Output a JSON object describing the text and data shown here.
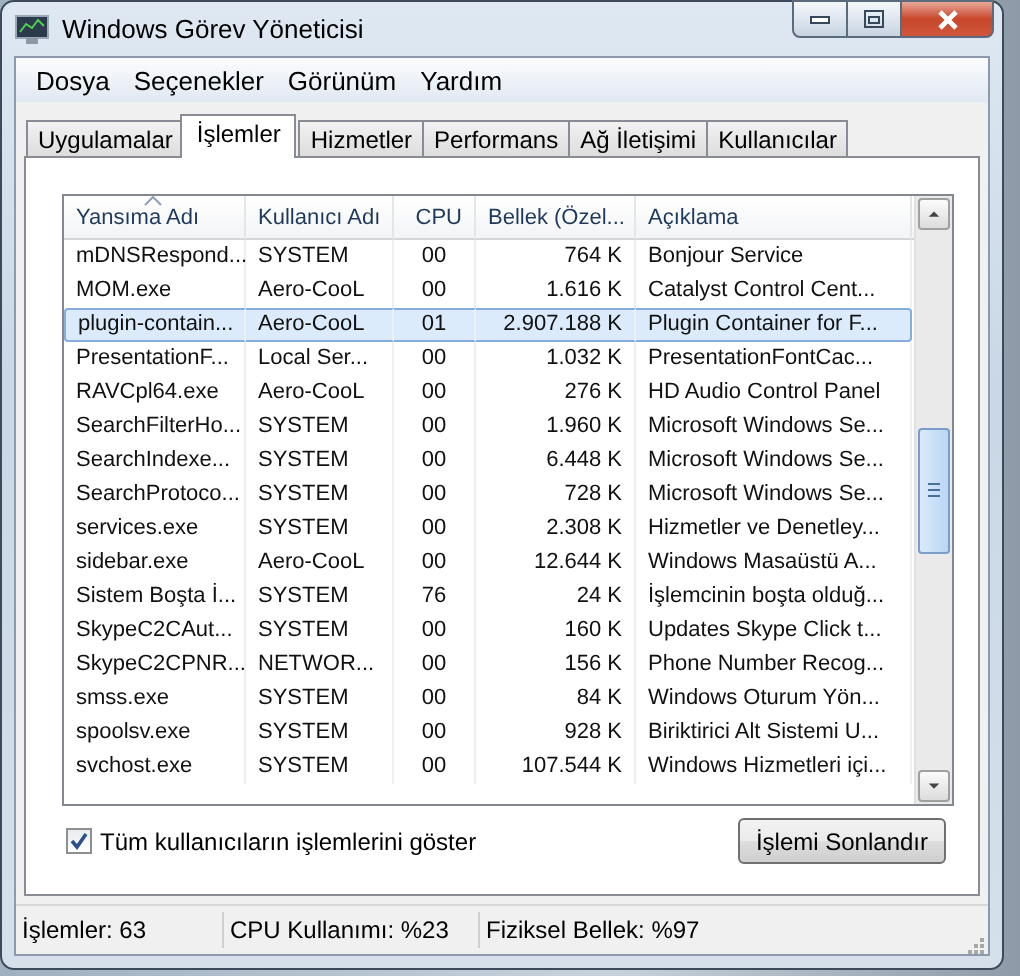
{
  "window": {
    "title": "Windows Görev Yöneticisi"
  },
  "menu": [
    "Dosya",
    "Seçenekler",
    "Görünüm",
    "Yardım"
  ],
  "tabs": [
    {
      "label": "Uygulamalar",
      "selected": false
    },
    {
      "label": "İşlemler",
      "selected": true
    },
    {
      "label": "Hizmetler",
      "selected": false
    },
    {
      "label": "Performans",
      "selected": false
    },
    {
      "label": "Ağ İletişimi",
      "selected": false
    },
    {
      "label": "Kullanıcılar",
      "selected": false
    }
  ],
  "process_table": {
    "columns": [
      {
        "label": "Yansıma Adı",
        "sorted": true
      },
      {
        "label": "Kullanıcı Adı",
        "sorted": false
      },
      {
        "label": "CPU",
        "sorted": false
      },
      {
        "label": "Bellek (Özel...",
        "sorted": false
      },
      {
        "label": "Açıklama",
        "sorted": false
      }
    ],
    "rows": [
      {
        "name": "mDNSRespond...",
        "user": "SYSTEM",
        "cpu": "00",
        "memory": "764 K",
        "description": "Bonjour Service",
        "selected": false
      },
      {
        "name": "MOM.exe",
        "user": "Aero-CooL",
        "cpu": "00",
        "memory": "1.616 K",
        "description": "Catalyst Control Cent...",
        "selected": false
      },
      {
        "name": "plugin-contain...",
        "user": "Aero-CooL",
        "cpu": "01",
        "memory": "2.907.188 K",
        "description": "Plugin Container for F...",
        "selected": true
      },
      {
        "name": "PresentationF...",
        "user": "Local Ser...",
        "cpu": "00",
        "memory": "1.032 K",
        "description": "PresentationFontCac...",
        "selected": false
      },
      {
        "name": "RAVCpl64.exe",
        "user": "Aero-CooL",
        "cpu": "00",
        "memory": "276 K",
        "description": "HD Audio Control Panel",
        "selected": false
      },
      {
        "name": "SearchFilterHo...",
        "user": "SYSTEM",
        "cpu": "00",
        "memory": "1.960 K",
        "description": "Microsoft Windows Se...",
        "selected": false
      },
      {
        "name": "SearchIndexe...",
        "user": "SYSTEM",
        "cpu": "00",
        "memory": "6.448 K",
        "description": "Microsoft Windows Se...",
        "selected": false
      },
      {
        "name": "SearchProtoco...",
        "user": "SYSTEM",
        "cpu": "00",
        "memory": "728 K",
        "description": "Microsoft Windows Se...",
        "selected": false
      },
      {
        "name": "services.exe",
        "user": "SYSTEM",
        "cpu": "00",
        "memory": "2.308 K",
        "description": "Hizmetler ve Denetley...",
        "selected": false
      },
      {
        "name": "sidebar.exe",
        "user": "Aero-CooL",
        "cpu": "00",
        "memory": "12.644 K",
        "description": "Windows Masaüstü A...",
        "selected": false
      },
      {
        "name": "Sistem Boşta İ...",
        "user": "SYSTEM",
        "cpu": "76",
        "memory": "24 K",
        "description": "İşlemcinin boşta olduğ...",
        "selected": false
      },
      {
        "name": "SkypeC2CAut...",
        "user": "SYSTEM",
        "cpu": "00",
        "memory": "160 K",
        "description": "Updates Skype Click t...",
        "selected": false
      },
      {
        "name": "SkypeC2CPNR...",
        "user": "NETWOR...",
        "cpu": "00",
        "memory": "156 K",
        "description": "Phone Number Recog...",
        "selected": false
      },
      {
        "name": "smss.exe",
        "user": "SYSTEM",
        "cpu": "00",
        "memory": "84 K",
        "description": "Windows Oturum Yön...",
        "selected": false
      },
      {
        "name": "spoolsv.exe",
        "user": "SYSTEM",
        "cpu": "00",
        "memory": "928 K",
        "description": "Biriktirici Alt Sistemi U...",
        "selected": false
      },
      {
        "name": "svchost.exe",
        "user": "SYSTEM",
        "cpu": "00",
        "memory": "107.544 K",
        "description": "Windows Hizmetleri içi...",
        "selected": false
      }
    ]
  },
  "show_all_users": {
    "label": "Tüm kullanıcıların işlemlerini göster",
    "checked": true
  },
  "end_process_button": "İşlemi Sonlandır",
  "status_bar": [
    "İşlemler: 63",
    "CPU Kullanımı: %23",
    "Fiziksel Bellek: %97"
  ]
}
